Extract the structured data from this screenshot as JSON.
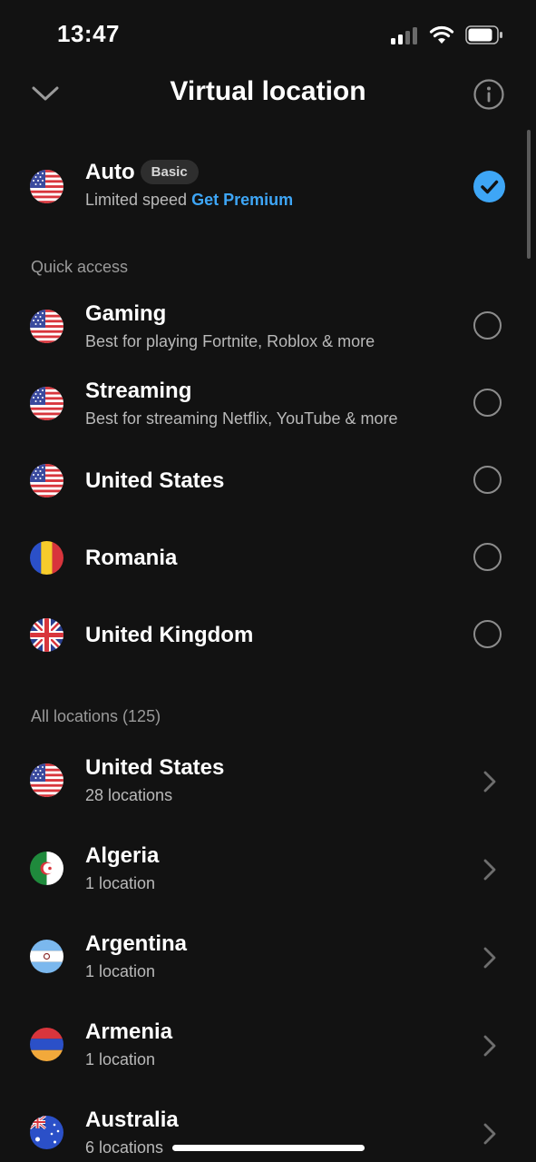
{
  "status": {
    "time": "13:47"
  },
  "header": {
    "title": "Virtual location"
  },
  "auto": {
    "title": "Auto",
    "badge": "Basic",
    "sub_prefix": "Limited speed",
    "premium_link": "Get Premium"
  },
  "quick_access": {
    "label": "Quick access",
    "items": [
      {
        "title": "Gaming",
        "sub": "Best for playing Fortnite, Roblox & more",
        "flag": "us-flag"
      },
      {
        "title": "Streaming",
        "sub": "Best for streaming Netflix, YouTube & more",
        "flag": "us-flag"
      },
      {
        "title": "United States",
        "flag": "us-flag"
      },
      {
        "title": "Romania",
        "flag": "romania-flag"
      },
      {
        "title": "United Kingdom",
        "flag": "uk-flag"
      }
    ]
  },
  "all_locations": {
    "label": "All locations (125)",
    "items": [
      {
        "title": "United States",
        "sub": "28 locations",
        "flag": "us-flag"
      },
      {
        "title": "Algeria",
        "sub": "1 location",
        "flag": "algeria-flag"
      },
      {
        "title": "Argentina",
        "sub": "1 location",
        "flag": "argentina-flag"
      },
      {
        "title": "Armenia",
        "sub": "1 location",
        "flag": "armenia-flag"
      },
      {
        "title": "Australia",
        "sub": "6 locations",
        "flag": "australia-flag"
      }
    ]
  },
  "colors": {
    "background": "#121212",
    "accent": "#3ea6f6",
    "secondary_text": "#b9b9b9"
  }
}
